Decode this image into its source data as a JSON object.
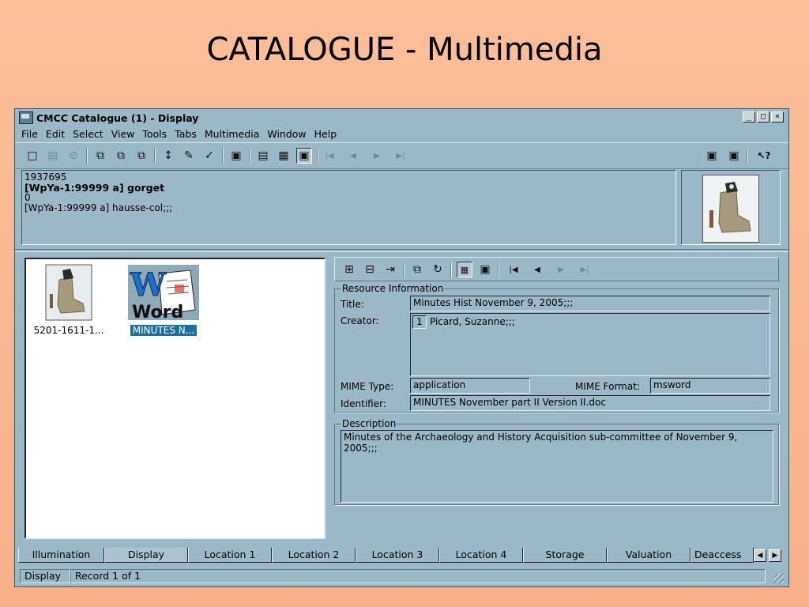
{
  "slide": {
    "title": "CATALOGUE - Multimedia"
  },
  "window": {
    "title": "CMCC Catalogue (1) - Display",
    "controls": {
      "minimize": "_",
      "maximize": "□",
      "close": "×"
    }
  },
  "menu": [
    "File",
    "Edit",
    "Select",
    "View",
    "Tools",
    "Tabs",
    "Multimedia",
    "Window",
    "Help"
  ],
  "toolbar": {
    "icons": {
      "new": "□",
      "save": "▤",
      "disabled": "⊘",
      "open": "⧉",
      "copy": "⧉",
      "paste": "⧉",
      "sort": "↕",
      "edit": "✎",
      "spell": "✓",
      "form": "▣",
      "list": "▤",
      "grid": "▦",
      "media": "▣",
      "first": "|◀",
      "prev": "◀",
      "next": "▶",
      "last": "▶|",
      "win1": "▣",
      "win2": "▣",
      "help": "↖?"
    }
  },
  "record": {
    "id": "1937695",
    "heading": "[WpYa-1:99999 a] gorget",
    "line3": "0",
    "line4": "[WpYa-1:99999 a] hausse-col;;;"
  },
  "list": {
    "items": [
      {
        "caption": "5201-1611-1...",
        "selected": false,
        "icon": "boot-thumbnail"
      },
      {
        "caption": "MINUTES N...",
        "selected": true,
        "icon": "word-document-icon"
      }
    ]
  },
  "resource": {
    "group_label": "Resource Information",
    "title_label": "Title:",
    "title_value": "Minutes Hist November 9, 2005;;;",
    "creator_label": "Creator:",
    "creator_index": "1",
    "creator_value": "Picard, Suzanne;;;",
    "mime_type_label": "MIME Type:",
    "mime_type_value": "application",
    "mime_format_label": "MIME Format:",
    "mime_format_value": "msword",
    "identifier_label": "Identifier:",
    "identifier_value": "MINUTES November part II Version II.doc"
  },
  "description": {
    "group_label": "Description",
    "text": "Minutes of the Archaeology and History Acquisition sub-committee of November 9, 2005;;;"
  },
  "tabs": [
    "Illumination",
    "Display",
    "Location 1",
    "Location 2",
    "Location 3",
    "Location 4",
    "Storage",
    "Valuation",
    "Deaccess"
  ],
  "status": {
    "mode": "Display",
    "record": "Record 1 of 1"
  }
}
